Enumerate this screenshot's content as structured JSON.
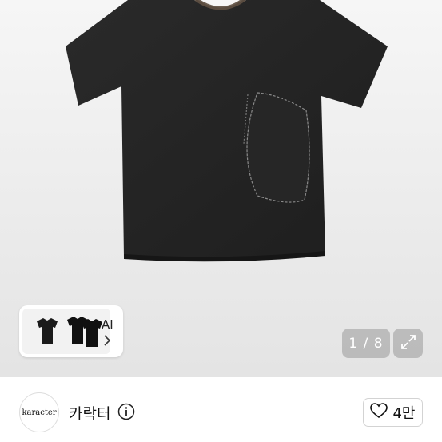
{
  "gallery": {
    "thumbnail_label": "AI",
    "page_indicator": "1 / 8"
  },
  "seller": {
    "avatar_text": "karacter",
    "name": "카락터"
  },
  "like": {
    "count": "4만"
  },
  "icons": {
    "expand": "expand-icon",
    "info": "info-icon",
    "heart": "heart-outline-icon",
    "chevron": "chevron-right-icon"
  }
}
